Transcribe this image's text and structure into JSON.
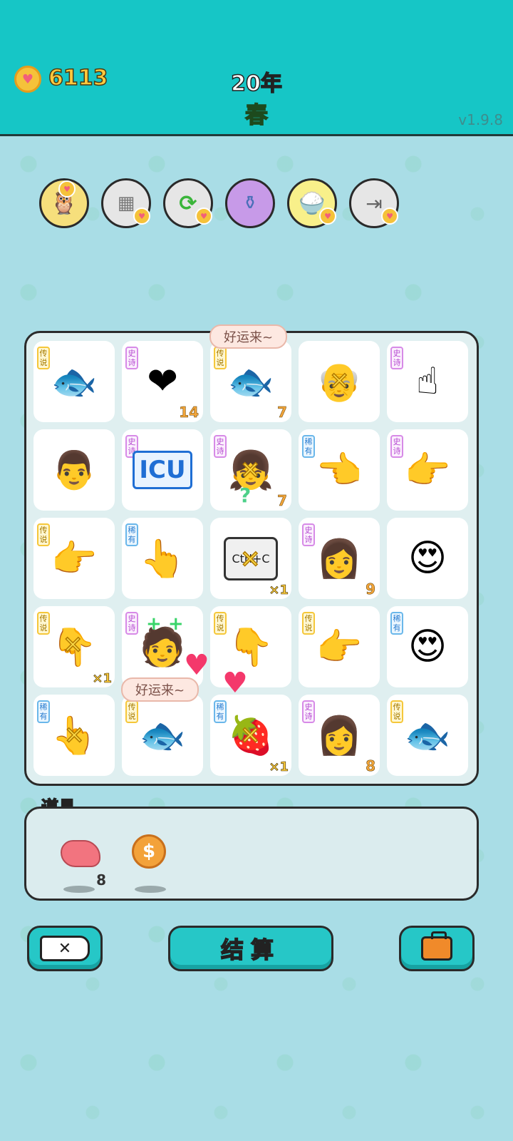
{
  "header": {
    "coins": "6113",
    "year": "20年",
    "season": "春",
    "version": "v1.9.8"
  },
  "skills": [
    {
      "icon": "owl-icon",
      "bg": "#f6df7c"
    },
    {
      "icon": "sugar-cubes-icon",
      "bg": "#e6e6e6"
    },
    {
      "icon": "refresh-icon",
      "bg": "#e6e6e6"
    },
    {
      "icon": "jar-icon",
      "bg": "#c79ae8"
    },
    {
      "icon": "rice-bowl-icon",
      "bg": "#f8f08a"
    },
    {
      "icon": "skip-icon",
      "bg": "#e6e6e6"
    }
  ],
  "grid": [
    [
      {
        "tag": "传说",
        "rarity": "leg",
        "icon": "koi-fish-icon",
        "glyph": "🐟"
      },
      {
        "tag": "史诗",
        "rarity": "epic",
        "icon": "heart-face-icon",
        "glyph": "❤",
        "count": "14"
      },
      {
        "tag": "传说",
        "rarity": "leg",
        "icon": "koi-fish-icon",
        "glyph": "🐟",
        "count": "7"
      },
      {
        "tag": "",
        "rarity": "",
        "icon": "bald-old-man-icon",
        "glyph": "👴"
      },
      {
        "tag": "史诗",
        "rarity": "epic",
        "icon": "pointing-up-hand-icon",
        "glyph": "☝"
      }
    ],
    [
      {
        "tag": "",
        "rarity": "",
        "icon": "glasses-man-icon",
        "glyph": "👨"
      },
      {
        "tag": "史诗",
        "rarity": "epic",
        "icon": "icu-sign-icon",
        "glyph": "",
        "text": "ICU"
      },
      {
        "tag": "史诗",
        "rarity": "epic",
        "icon": "braided-girl-icon",
        "glyph": "👧",
        "count": "7"
      },
      {
        "tag": "稀有",
        "rarity": "rare",
        "icon": "pointing-left-hand-icon",
        "glyph": "👈"
      },
      {
        "tag": "史诗",
        "rarity": "epic",
        "icon": "pointing-hand-icon",
        "glyph": "👉"
      }
    ],
    [
      {
        "tag": "传说",
        "rarity": "leg",
        "icon": "pointing-hand-icon",
        "glyph": "👉"
      },
      {
        "tag": "稀有",
        "rarity": "rare",
        "icon": "pointing-hand-icon",
        "glyph": "👆"
      },
      {
        "tag": "",
        "rarity": "",
        "icon": "copy-paste-card-icon",
        "glyph": "",
        "text": "Ctrl+C",
        "mult": "×1"
      },
      {
        "tag": "史诗",
        "rarity": "epic",
        "icon": "braided-girl-icon",
        "glyph": "👩",
        "count": "9"
      },
      {
        "tag": "",
        "rarity": "",
        "icon": "heart-eyes-man-icon",
        "glyph": "😍"
      }
    ],
    [
      {
        "tag": "传说",
        "rarity": "leg",
        "icon": "pointing-down-hand-icon",
        "glyph": "👇",
        "mult": "×1"
      },
      {
        "tag": "史诗",
        "rarity": "epic",
        "icon": "green-hair-man-icon",
        "glyph": "🧑"
      },
      {
        "tag": "传说",
        "rarity": "leg",
        "icon": "pointing-down-hand-icon",
        "glyph": "👇"
      },
      {
        "tag": "传说",
        "rarity": "leg",
        "icon": "pointing-hand-icon",
        "glyph": "👉"
      },
      {
        "tag": "稀有",
        "rarity": "rare",
        "icon": "heart-eyes-bald-man-icon",
        "glyph": "😍"
      }
    ],
    [
      {
        "tag": "稀有",
        "rarity": "rare",
        "icon": "pointing-hand-icon",
        "glyph": "👆"
      },
      {
        "tag": "传说",
        "rarity": "leg",
        "icon": "koi-fish-icon",
        "glyph": "🐟"
      },
      {
        "tag": "稀有",
        "rarity": "rare",
        "icon": "lychee-icon",
        "glyph": "🍓",
        "mult": "×1"
      },
      {
        "tag": "史诗",
        "rarity": "epic",
        "icon": "braided-girl-icon",
        "glyph": "👩",
        "count": "8"
      },
      {
        "tag": "传说",
        "rarity": "leg",
        "icon": "koi-fish-icon",
        "glyph": "🐟"
      }
    ]
  ],
  "bubbles": {
    "top": "好运来~",
    "bottom": "好运来~"
  },
  "items": {
    "title": "道具",
    "list": [
      {
        "icon": "liver-icon",
        "count": "8"
      },
      {
        "icon": "coin-icon",
        "count": ""
      }
    ]
  },
  "buttons": {
    "quit_icon": "close-icon",
    "settle_label": "结算",
    "bag_icon": "briefcase-icon"
  }
}
